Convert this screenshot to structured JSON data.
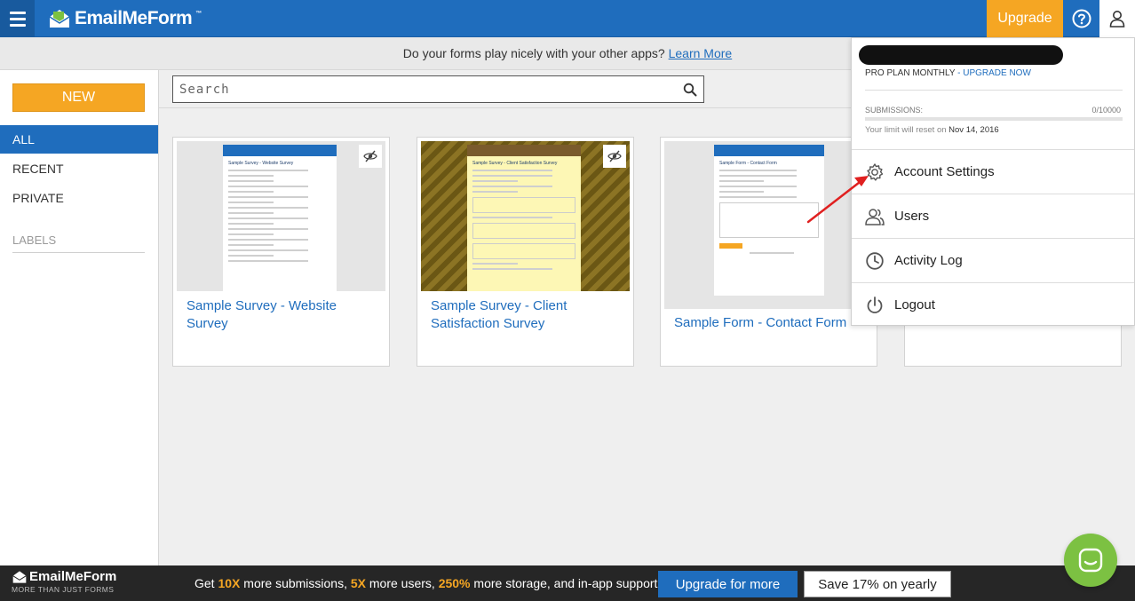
{
  "header": {
    "logo_text": "EmailMeForm",
    "logo_tm": "™",
    "upgrade_label": "Upgrade"
  },
  "notice": {
    "text": "Do your forms play nicely with your other apps?",
    "link": "Learn More"
  },
  "sidebar": {
    "new_label": "NEW",
    "items": [
      {
        "label": "ALL",
        "active": true
      },
      {
        "label": "RECENT",
        "active": false
      },
      {
        "label": "PRIVATE",
        "active": false
      }
    ],
    "labels_heading": "LABELS"
  },
  "search": {
    "placeholder": "Search"
  },
  "forms": [
    {
      "title": "Sample Survey - Website Survey",
      "thumb_title": "Sample Survey - Website Survey"
    },
    {
      "title": "Sample Survey - Client Satisfaction Survey",
      "thumb_title": "Sample Survey - Client Satisfaction Survey"
    },
    {
      "title": "Sample Form - Contact Form",
      "thumb_title": "Sample Form - Contact Form"
    }
  ],
  "account_menu": {
    "plan": "PRO PLAN MONTHLY",
    "plan_sep": " - ",
    "upgrade_now": "UPGRADE NOW",
    "submissions_label": "SUBMISSIONS:",
    "submissions_value": "0/10000",
    "submissions_fraction": 0,
    "reset_text": "Your limit will reset on ",
    "reset_date": "Nov 14, 2016",
    "items": [
      {
        "label": "Account Settings",
        "icon": "gear-icon"
      },
      {
        "label": "Users",
        "icon": "users-icon"
      },
      {
        "label": "Activity Log",
        "icon": "clock-icon"
      },
      {
        "label": "Logout",
        "icon": "power-icon"
      }
    ]
  },
  "footer": {
    "logo_text": "EmailMeForm",
    "tagline": "MORE THAN JUST FORMS",
    "promo": {
      "p1": "Get ",
      "h1": "10X",
      "p2": " more submissions, ",
      "h2": "5X",
      "p3": " more users, ",
      "h3": "250%",
      "p4": " more storage, and in-app support."
    },
    "upgrade_more": "Upgrade for more",
    "save_yearly": "Save 17% on yearly"
  },
  "colors": {
    "brand_blue": "#1f6dbd",
    "accent_orange": "#f5a623",
    "chat_green": "#7cc142",
    "arrow_red": "#e02020"
  }
}
